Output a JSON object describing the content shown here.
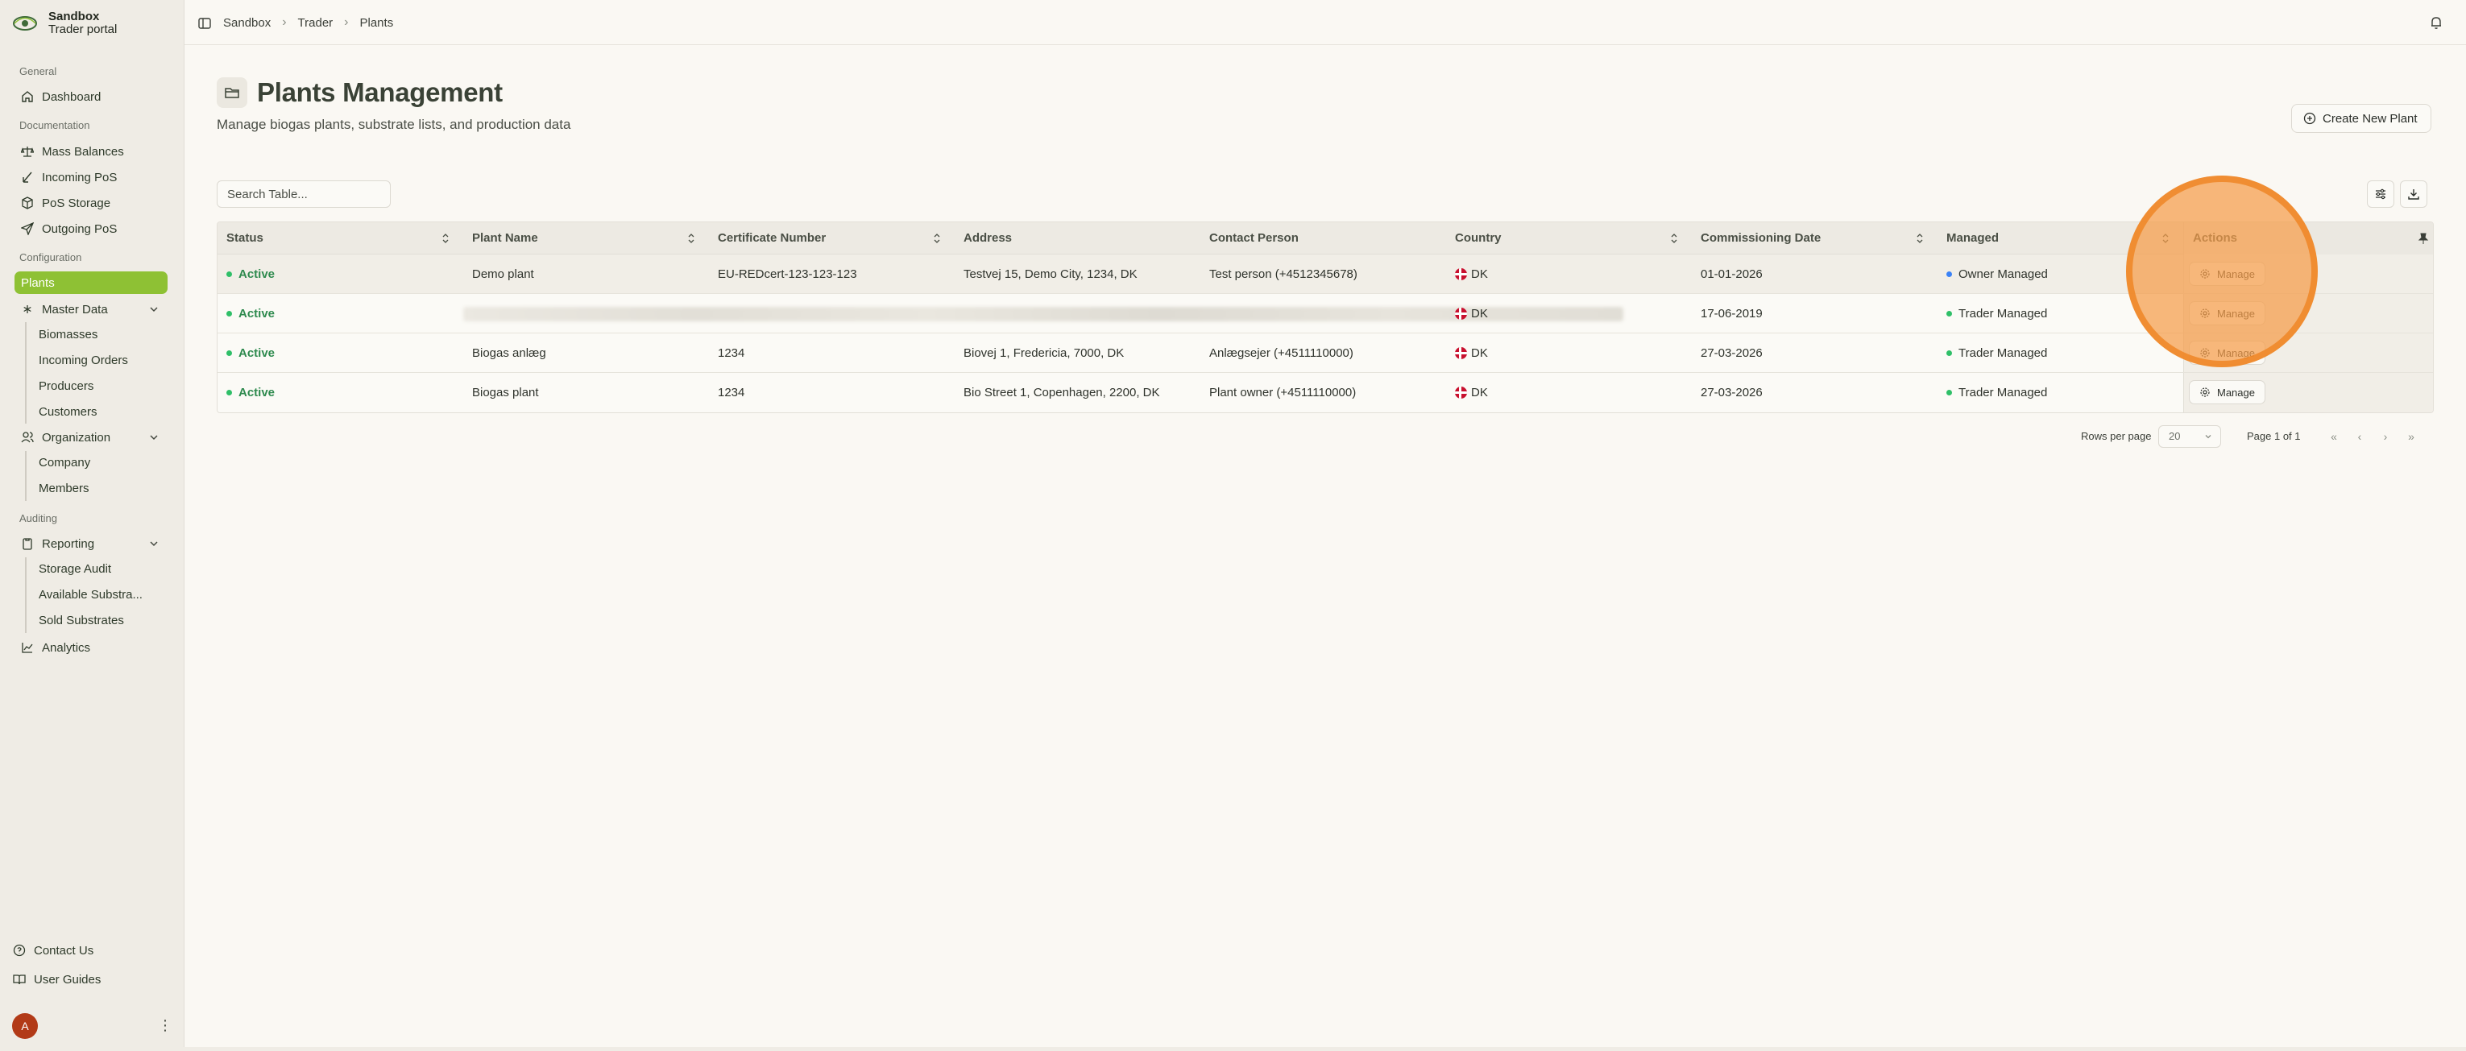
{
  "app": {
    "brand_name": "Sandbox",
    "brand_sub": "Trader portal"
  },
  "sidebar": {
    "sections": {
      "general": "General",
      "documentation": "Documentation",
      "configuration": "Configuration",
      "auditing": "Auditing"
    },
    "items": {
      "dashboard": "Dashboard",
      "mass_balances": "Mass Balances",
      "incoming_pos": "Incoming PoS",
      "pos_storage": "PoS Storage",
      "outgoing_pos": "Outgoing PoS",
      "plants": "Plants",
      "master_data": "Master Data",
      "biomasses": "Biomasses",
      "incoming_orders": "Incoming Orders",
      "producers": "Producers",
      "customers": "Customers",
      "organization": "Organization",
      "company": "Company",
      "members": "Members",
      "reporting": "Reporting",
      "storage_audit": "Storage Audit",
      "available_substrates": "Available Substra...",
      "sold_substrates": "Sold Substrates",
      "analytics": "Analytics",
      "contact_us": "Contact Us",
      "user_guides": "User Guides"
    },
    "avatar_initial": "A"
  },
  "breadcrumb": [
    "Sandbox",
    "Trader",
    "Plants"
  ],
  "page": {
    "title": "Plants Management",
    "subtitle": "Manage biogas plants, substrate lists, and production data",
    "create_button": "Create New Plant",
    "search_placeholder": "Search Table..."
  },
  "table": {
    "headers": {
      "status": "Status",
      "plant_name": "Plant Name",
      "certificate_number": "Certificate Number",
      "address": "Address",
      "contact_person": "Contact Person",
      "country": "Country",
      "commissioning_date": "Commissioning Date",
      "managed": "Managed",
      "actions": "Actions"
    },
    "rows": [
      {
        "status": "Active",
        "plant_name": "Demo plant",
        "certificate_number": "EU-REDcert-123-123-123",
        "address": "Testvej 15, Demo City, 1234, DK",
        "contact_person": "Test person (+4512345678)",
        "country": "DK",
        "commissioning_date": "01-01-2026",
        "managed": "Owner Managed",
        "action": "Manage"
      },
      {
        "status": "Active",
        "plant_name": "",
        "certificate_number": "",
        "address": "",
        "contact_person": "",
        "country": "DK",
        "commissioning_date": "17-06-2019",
        "managed": "Trader Managed",
        "action": "Manage"
      },
      {
        "status": "Active",
        "plant_name": "Biogas anlæg",
        "certificate_number": "1234",
        "address": "Biovej 1, Fredericia, 7000, DK",
        "contact_person": "Anlægsejer (+4511110000)",
        "country": "DK",
        "commissioning_date": "27-03-2026",
        "managed": "Trader Managed",
        "action": "Manage"
      },
      {
        "status": "Active",
        "plant_name": "Biogas plant",
        "certificate_number": "1234",
        "address": "Bio Street 1, Copenhagen, 2200, DK",
        "contact_person": "Plant owner (+4511110000)",
        "country": "DK",
        "commissioning_date": "27-03-2026",
        "managed": "Trader Managed",
        "action": "Manage"
      }
    ]
  },
  "pagination": {
    "rows_per_page_label": "Rows per page",
    "rows_per_page_value": "20",
    "page_label": "Page 1 of 1"
  },
  "colors": {
    "accent": "#8ec134",
    "active_status": "#2e8a4e",
    "highlight": "#f59c4a"
  }
}
